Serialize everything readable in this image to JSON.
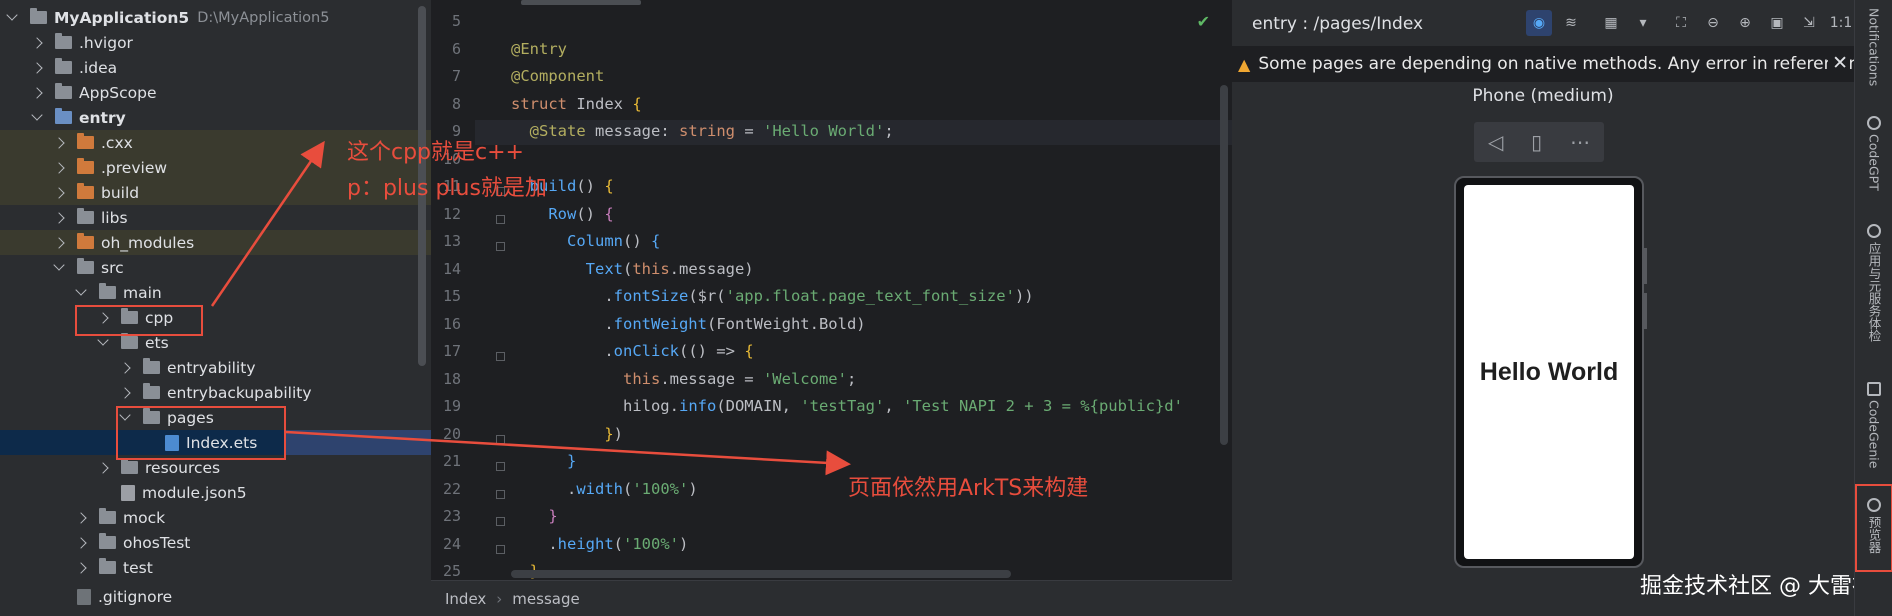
{
  "project": {
    "root_name": "MyApplication5",
    "root_path": "D:\\MyApplication5",
    "items": [
      {
        "label": "MyApplication5"
      },
      {
        "label": ".hvigor"
      },
      {
        "label": ".idea"
      },
      {
        "label": "AppScope"
      },
      {
        "label": "entry"
      },
      {
        "label": ".cxx"
      },
      {
        "label": ".preview"
      },
      {
        "label": "build"
      },
      {
        "label": "libs"
      },
      {
        "label": "oh_modules"
      },
      {
        "label": "src"
      },
      {
        "label": "main"
      },
      {
        "label": "cpp"
      },
      {
        "label": "ets"
      },
      {
        "label": "entryability"
      },
      {
        "label": "entrybackupability"
      },
      {
        "label": "pages"
      },
      {
        "label": "Index.ets"
      },
      {
        "label": "resources"
      },
      {
        "label": "module.json5"
      },
      {
        "label": "mock"
      },
      {
        "label": "ohosTest"
      },
      {
        "label": "test"
      },
      {
        "label": ".gitignore"
      }
    ]
  },
  "editor": {
    "line_numbers": [
      "5",
      "6",
      "7",
      "8",
      "9",
      "10",
      "11",
      "12",
      "13",
      "14",
      "15",
      "16",
      "17",
      "18",
      "19",
      "20",
      "21",
      "22",
      "23",
      "24",
      "25"
    ],
    "breadcrumb": [
      "Index",
      "message"
    ]
  },
  "previewer": {
    "title": "entry : /pages/Index",
    "warning": "Some pages are depending on native methods. Any error in referencing the native methods may cause the previewer to not work properly.",
    "device": "Phone (medium)",
    "screen_text": "Hello World"
  },
  "side_strip": {
    "items": [
      "Notifications",
      "CodeGPT",
      "应用与元服务体检",
      "CodeGenie",
      "预览器"
    ]
  },
  "annotations": {
    "cpp_note_line1": "这个cpp就是c++",
    "cpp_note_line2": "p：plus  plus就是加",
    "pages_note": "页面依然用ArkTS来构建",
    "watermark": "掘金技术社区 @ 大雷神"
  },
  "colors": {
    "annotation": "#e84d3d",
    "editor_bg": "#1e1f22",
    "panel_bg": "#2b2d30",
    "selection": "#2e436e"
  }
}
